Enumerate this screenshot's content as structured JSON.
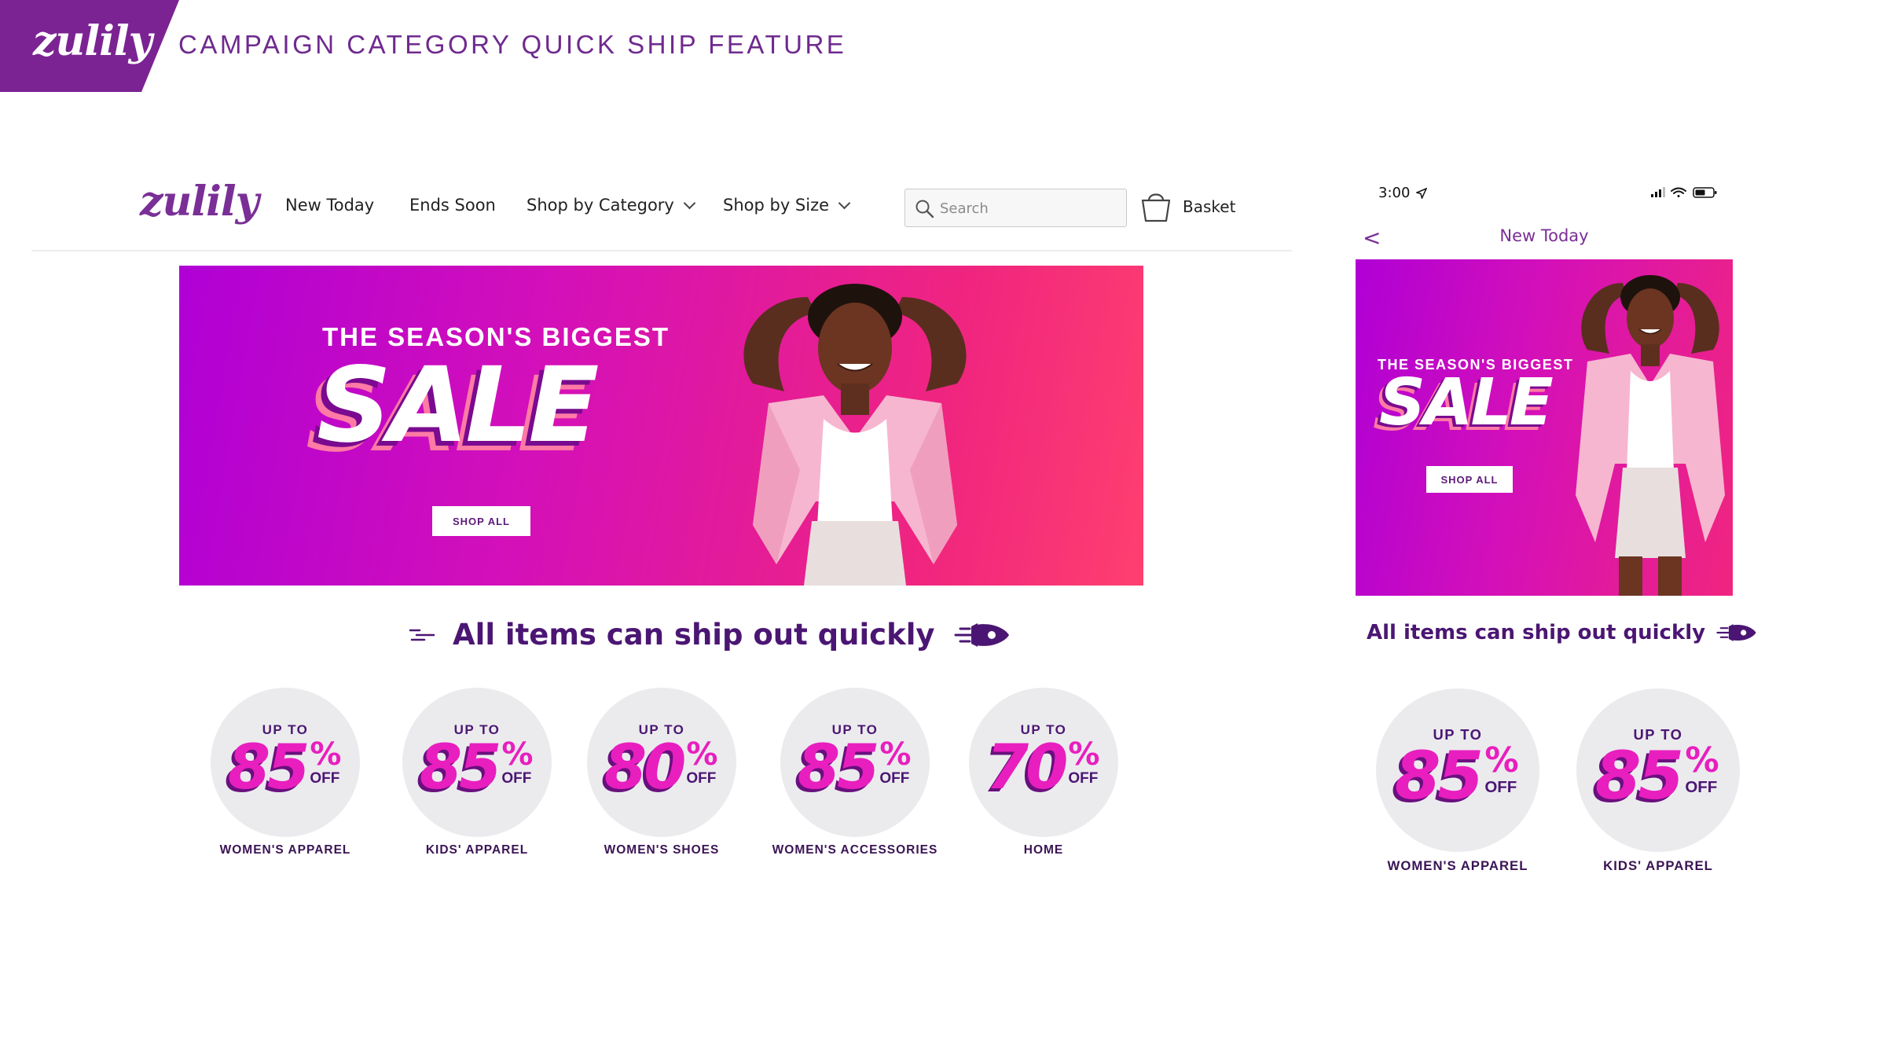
{
  "slide": {
    "logo": "zulily",
    "title": "CAMPAIGN CATEGORY QUICK SHIP FEATURE",
    "accent_color": "#7b2393"
  },
  "desktop": {
    "logo": "zulily",
    "nav": [
      {
        "label": "New Today",
        "dropdown": false
      },
      {
        "label": "Ends Soon",
        "dropdown": false
      },
      {
        "label": "Shop by Category",
        "dropdown": true
      },
      {
        "label": "Shop by Size",
        "dropdown": true
      }
    ],
    "search_placeholder": "Search",
    "basket_label": "Basket",
    "banner": {
      "kicker": "THE SEASON'S BIGGEST",
      "headline": "SALE",
      "button": "SHOP ALL",
      "model": "woman-in-pink-shirt-photo"
    },
    "ship_message": "All items can ship out quickly",
    "categories": [
      {
        "upto": "UP TO",
        "percent": "85",
        "off": "OFF",
        "label": "WOMEN'S APPAREL"
      },
      {
        "upto": "UP TO",
        "percent": "85",
        "off": "OFF",
        "label": "KIDS' APPAREL"
      },
      {
        "upto": "UP TO",
        "percent": "80",
        "off": "OFF",
        "label": "WOMEN'S SHOES"
      },
      {
        "upto": "UP TO",
        "percent": "85",
        "off": "OFF",
        "label": "WOMEN'S ACCESSORIES"
      },
      {
        "upto": "UP TO",
        "percent": "70",
        "off": "OFF",
        "label": "HOME"
      }
    ]
  },
  "mobile": {
    "status_time": "3:00",
    "status_icons": [
      "location-arrow-icon",
      "signal-icon",
      "wifi-icon",
      "battery-icon"
    ],
    "back_label": "<",
    "title": "New Today",
    "banner": {
      "kicker": "THE SEASON'S BIGGEST",
      "headline": "SALE",
      "button": "SHOP ALL"
    },
    "ship_message": "All items can ship out quickly",
    "categories": [
      {
        "upto": "UP TO",
        "percent": "85",
        "off": "OFF",
        "label": "WOMEN'S APPAREL"
      },
      {
        "upto": "UP TO",
        "percent": "85",
        "off": "OFF",
        "label": "KIDS' APPAREL"
      }
    ]
  },
  "colors": {
    "brand_purple": "#7b2393",
    "dark_purple": "#4b1673",
    "magenta": "#e81fbe",
    "circle_bg": "#ebebee"
  },
  "pct_symbol": "%"
}
